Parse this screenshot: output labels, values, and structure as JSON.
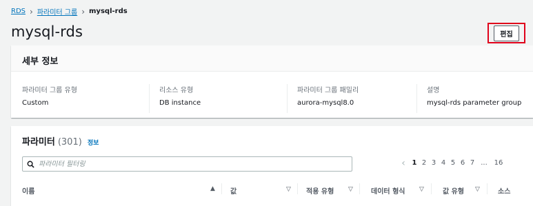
{
  "breadcrumb": {
    "items": [
      "RDS",
      "파라미터 그룹"
    ],
    "current": "mysql-rds"
  },
  "page": {
    "title": "mysql-rds",
    "edit_label": "편집"
  },
  "details": {
    "title": "세부 정보",
    "fields": [
      {
        "label": "파라미터 그룹 유형",
        "value": "Custom"
      },
      {
        "label": "리소스 유형",
        "value": "DB instance"
      },
      {
        "label": "파라미터 그룹 패밀리",
        "value": "aurora-mysql8.0"
      },
      {
        "label": "설명",
        "value": "mysql-rds parameter group"
      }
    ]
  },
  "parameters": {
    "title": "파라미터",
    "count": "(301)",
    "info_label": "정보",
    "search_placeholder": "파라미터 필터링",
    "pagination": {
      "pages": [
        "1",
        "2",
        "3",
        "4",
        "5",
        "6",
        "7"
      ],
      "current": "1",
      "ellipsis": "...",
      "last": "16"
    },
    "columns": [
      "이름",
      "값",
      "적용 유형",
      "데이터 형식",
      "값 유형",
      "소스"
    ]
  },
  "colors": {
    "link": "#0073bb",
    "highlight_border": "#e0001a",
    "background": "#f2f3f3"
  }
}
